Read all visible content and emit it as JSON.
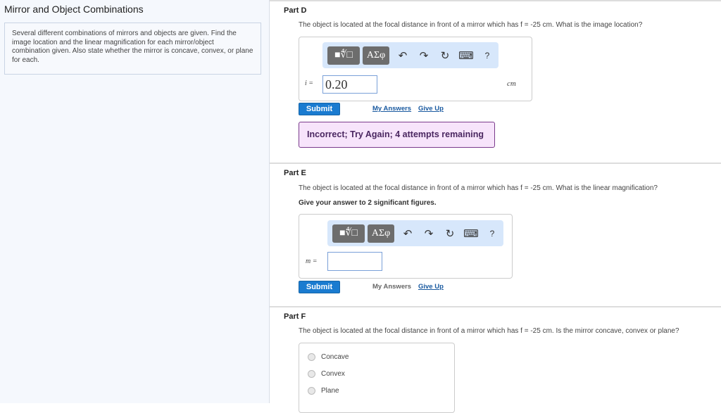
{
  "sidebar": {
    "title": "Mirror and Object Combinations",
    "intro": "Several different combinations of mirrors and objects are given. Find the image location and the linear magnification for each mirror/object combination given. Also state whether the mirror is concave, convex, or plane for each."
  },
  "toolbar": {
    "templates": "■∜□",
    "greek": "ΑΣφ",
    "undo": "↶",
    "redo": "↷",
    "reset": "↻",
    "keyboard": "⌨",
    "help": "?"
  },
  "partD": {
    "label": "Part D",
    "question": "The object is located at the focal distance in front of a mirror which has f = -25 cm. What is the image location?",
    "var_label": "i =",
    "value": "0.20",
    "unit": "cm",
    "submit": "Submit",
    "my_answers": "My Answers",
    "give_up": "Give Up",
    "feedback": "Incorrect; Try Again; 4 attempts remaining"
  },
  "partE": {
    "label": "Part E",
    "question": "The object is located at the focal distance in front of a mirror which has f = -25 cm. What is the linear magnification?",
    "instruction": "Give your answer to 2 significant figures.",
    "var_label": "m =",
    "value": "",
    "submit": "Submit",
    "my_answers": "My Answers",
    "give_up": "Give Up"
  },
  "partF": {
    "label": "Part F",
    "question": "The object is located at the focal distance in front of a mirror which has f = -25 cm. Is the mirror concave, convex or plane?",
    "options": [
      "Concave",
      "Convex",
      "Plane"
    ]
  }
}
